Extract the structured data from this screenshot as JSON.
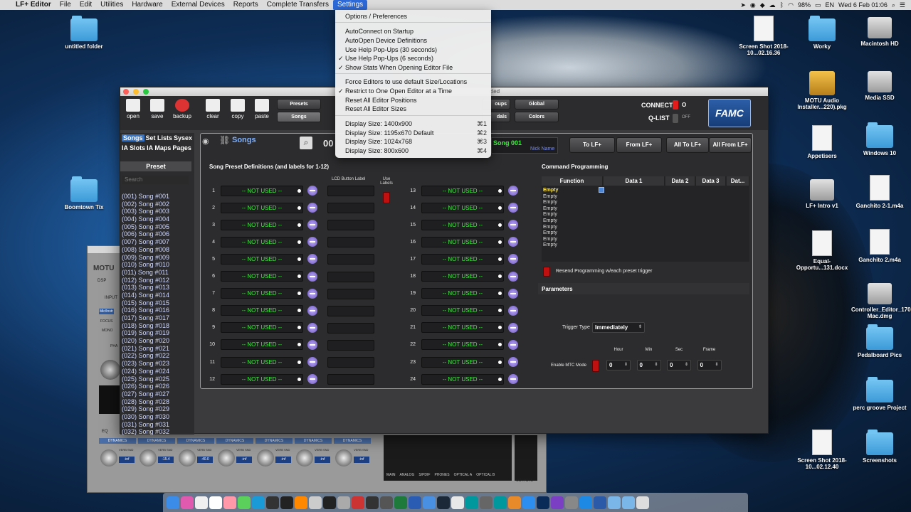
{
  "menubar": {
    "app": "LF+ Editor",
    "items": [
      "File",
      "Edit",
      "Utilities",
      "Hardware",
      "External Devices",
      "Reports",
      "Complete Transfers"
    ],
    "active": "Settings",
    "status": {
      "battery": "98%",
      "input": "EN",
      "datetime": "Wed 6 Feb  01:06"
    }
  },
  "settings_menu": {
    "items": [
      {
        "label": "Options / Preferences",
        "check": "",
        "shortcut": ""
      },
      {
        "label": "AutoConnect on Startup",
        "check": "",
        "shortcut": ""
      },
      {
        "label": "AutoOpen Device Definitions",
        "check": "",
        "shortcut": ""
      },
      {
        "label": "Use Help Pop-Ups (30 seconds)",
        "check": "",
        "shortcut": ""
      },
      {
        "label": "Use Help Pop-Ups (6 seconds)",
        "check": "✓",
        "shortcut": ""
      },
      {
        "label": "Show Stats When Opening Editor File",
        "check": "✓",
        "shortcut": ""
      },
      {
        "label": "Force Editors to use default Size/Locations",
        "check": "",
        "shortcut": ""
      },
      {
        "label": "Restrict to One Open Editor at a Time",
        "check": "✓",
        "shortcut": ""
      },
      {
        "label": "Reset All Editor Positions",
        "check": "",
        "shortcut": ""
      },
      {
        "label": "Reset All Editor Sizes",
        "check": "",
        "shortcut": ""
      },
      {
        "label": "Display Size: 1400x900",
        "check": "",
        "shortcut": "⌘1"
      },
      {
        "label": "Display Size: 1195x670 Default",
        "check": "",
        "shortcut": "⌘2"
      },
      {
        "label": "Display Size: 1024x768",
        "check": "",
        "shortcut": "⌘3"
      },
      {
        "label": "Display Size: 800x600",
        "check": "",
        "shortcut": "⌘4"
      }
    ]
  },
  "toolbar": {
    "buttons": [
      "open",
      "save",
      "backup",
      "clear",
      "copy",
      "paste"
    ],
    "nav": [
      "Presets",
      "Songs",
      "Global",
      "Colors"
    ],
    "nav_partial": [
      "oups",
      "dals"
    ],
    "title_partial": "cted",
    "connect_label": "CONNECT",
    "connect_state": "O",
    "qlist_label": "Q-LIST",
    "qlist_state": "OFF",
    "logo": "FAMC"
  },
  "sidebar": {
    "tabs": [
      "Songs",
      "Set Lists",
      "Sysex",
      "IA Slots",
      "IA Maps",
      "Pages"
    ],
    "preset_header": "Preset",
    "search_placeholder": "Search",
    "songs": [
      "(001) Song #001",
      "(002) Song #002",
      "(003) Song #003",
      "(004) Song #004",
      "(005) Song #005",
      "(006) Song #006",
      "(007) Song #007",
      "(008) Song #008",
      "(009) Song #009",
      "(010) Song #010",
      "(011) Song #011",
      "(012) Song #012",
      "(013) Song #013",
      "(014) Song #014",
      "(015) Song #015",
      "(016) Song #016",
      "(017) Song #017",
      "(018) Song #018",
      "(019) Song #019",
      "(020) Song #020",
      "(021) Song #021",
      "(022) Song #022",
      "(023) Song #023",
      "(024) Song #024",
      "(025) Song #025",
      "(026) Song #026",
      "(027) Song #027",
      "(028) Song #028",
      "(029) Song #029",
      "(030) Song #030",
      "(031) Song #031",
      "(032) Song #032"
    ]
  },
  "songs_panel": {
    "title": "Songs",
    "number_partial": "00",
    "song_name": "Song 001",
    "nick_name": "Nick Name",
    "actions": [
      "To LF+",
      "From LF+",
      "All To LF+",
      "All From LF+"
    ],
    "defs_header": "Song Preset Definitions (and labels for 1-12)",
    "lcd_label_header": "LCD Button Label",
    "use_labels_header": "Use Labels",
    "left_slots": [
      {
        "num": "1",
        "value": "-- NOT USED --"
      },
      {
        "num": "2",
        "value": "-- NOT USED --"
      },
      {
        "num": "3",
        "value": "-- NOT USED --"
      },
      {
        "num": "4",
        "value": "-- NOT USED --"
      },
      {
        "num": "5",
        "value": "-- NOT USED --"
      },
      {
        "num": "6",
        "value": "-- NOT USED --"
      },
      {
        "num": "7",
        "value": "-- NOT USED --"
      },
      {
        "num": "8",
        "value": "-- NOT USED --"
      },
      {
        "num": "9",
        "value": "-- NOT USED --"
      },
      {
        "num": "10",
        "value": "-- NOT USED --"
      },
      {
        "num": "11",
        "value": "-- NOT USED --"
      },
      {
        "num": "12",
        "value": "-- NOT USED --"
      }
    ],
    "right_slots": [
      {
        "num": "13",
        "value": "-- NOT USED --"
      },
      {
        "num": "14",
        "value": "-- NOT USED --"
      },
      {
        "num": "15",
        "value": "-- NOT USED --"
      },
      {
        "num": "16",
        "value": "-- NOT USED --"
      },
      {
        "num": "17",
        "value": "-- NOT USED --"
      },
      {
        "num": "18",
        "value": "-- NOT USED --"
      },
      {
        "num": "19",
        "value": "-- NOT USED --"
      },
      {
        "num": "20",
        "value": "-- NOT USED --"
      },
      {
        "num": "21",
        "value": "-- NOT USED --"
      },
      {
        "num": "22",
        "value": "-- NOT USED --"
      },
      {
        "num": "23",
        "value": "-- NOT USED --"
      },
      {
        "num": "24",
        "value": "-- NOT USED --"
      }
    ],
    "cmd_header": "Command Programming",
    "cmd_columns": [
      "Function",
      "Data 1",
      "Data 2",
      "Data 3",
      "Dat..."
    ],
    "cmd_rows": [
      "Empty",
      "Empty",
      "Empty",
      "Empty",
      "Empty",
      "Empty",
      "Empty",
      "Empty",
      "Empty",
      "Empty"
    ],
    "resend_label": "Resend Programming w/each preset trigger",
    "params_header": "Parameters",
    "trigger_label": "Trigger Type",
    "trigger_value": "Immediately",
    "mtc_label": "Enable MTC Mode",
    "mtc_fields": [
      {
        "label": "Hour",
        "value": "0"
      },
      {
        "label": "Min",
        "value": "0"
      },
      {
        "label": "Sec",
        "value": "0"
      },
      {
        "label": "Frame",
        "value": "0"
      }
    ]
  },
  "desktop": {
    "left": [
      "untitled folder",
      "Boomtown Tix"
    ],
    "right": [
      "Screen Shot 2018-10...02.16.36",
      "Worky",
      "Macintosh HD",
      "MOTU Audio Installer...220).pkg",
      "Media SSD",
      "Appetisers",
      "Windows 10",
      "LF+ Intro v1",
      "Ganchito 2-1.m4a",
      "Equal-Opportu...131.docx",
      "Ganchito 2.m4a",
      "Controller_Editor_170 Mac.dmg",
      "Pedalboard Pics",
      "perc groove Project",
      "Screen Shot 2018-10...02.12.40",
      "Screenshots"
    ]
  },
  "bg_mixer": {
    "strip_label": "DYNAMICS",
    "verb_label": "VERB SND",
    "values": [
      "-inf",
      "-15.4",
      "-40.0",
      "-inf",
      "-inf",
      "-inf",
      "-inf"
    ],
    "meter_labels": [
      "MAIN",
      "ANALOG",
      "S/PDIF",
      "PHONES",
      "OPTICAL A",
      "OPTICAL B"
    ],
    "outputs_label": "OUTPUTS",
    "side_labels": [
      "MOTU",
      "DSP",
      "INPUT",
      "Mic/Instr",
      "FOCUS",
      "MONO",
      "PHA",
      "EQ"
    ]
  }
}
